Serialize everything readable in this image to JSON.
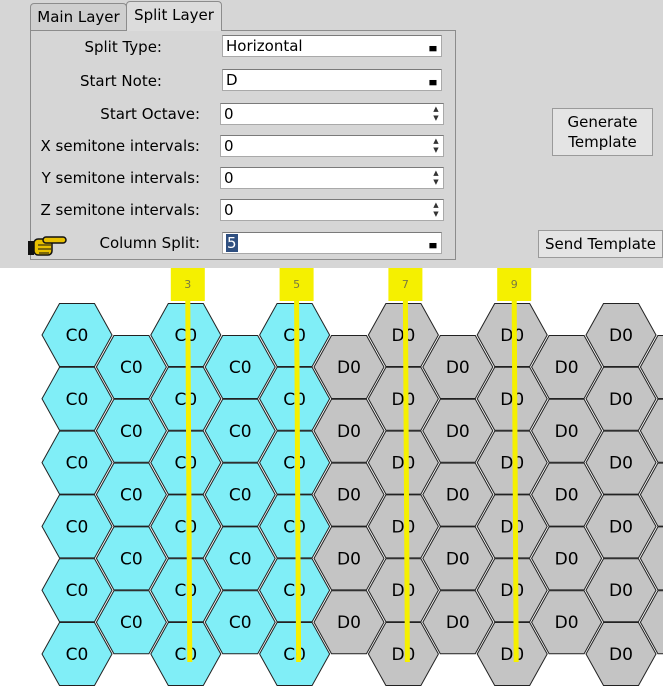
{
  "tabs": [
    "Main Layer",
    "Split Layer"
  ],
  "form": {
    "split_type": {
      "label": "Split Type:",
      "value": "Horizontal"
    },
    "start_note": {
      "label": "Start Note:",
      "value": "D"
    },
    "start_octave": {
      "label": "Start Octave:",
      "value": "0"
    },
    "x_semitone": {
      "label": "X semitone intervals:",
      "value": "0"
    },
    "y_semitone": {
      "label": "Y semitone intervals:",
      "value": "0"
    },
    "z_semitone": {
      "label": "Z semitone intervals:",
      "value": "0"
    },
    "column_split": {
      "label": "Column Split:",
      "value": "5"
    }
  },
  "buttons": {
    "generate": "Generate Template",
    "send": "Send Template"
  },
  "hex_grid": {
    "label_left": "C0",
    "label_right": "D0",
    "columns": 12,
    "split_column": 5,
    "colors": {
      "left": "#80eef7",
      "right": "#c4c4c4",
      "stroke": "#222222"
    }
  },
  "markers": [
    {
      "label": "3",
      "column": 3
    },
    {
      "label": "5",
      "column": 5
    },
    {
      "label": "7",
      "column": 7
    },
    {
      "label": "9",
      "column": 9
    }
  ],
  "marker_color": "#f5f000"
}
